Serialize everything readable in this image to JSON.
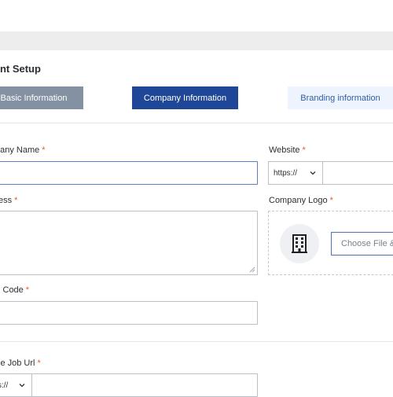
{
  "page": {
    "title": "unt Setup"
  },
  "steps": {
    "basic": "Basic Information",
    "company": "Company Information",
    "branding": "Branding information"
  },
  "form": {
    "company_name": {
      "label": "pany Name",
      "required_mark": "*",
      "value": ""
    },
    "address": {
      "label": "ess",
      "required_mark": "*",
      "value": ""
    },
    "postal_code": {
      "label": "l Code",
      "required_mark": "*",
      "value": ""
    },
    "job_url": {
      "label": "le Job Url",
      "required_mark": "*",
      "protocol": "s://",
      "value": ""
    },
    "website": {
      "label": "Website",
      "required_mark": "*",
      "protocol": "https://",
      "value": ""
    },
    "company_logo": {
      "label": "Company Logo",
      "required_mark": "*",
      "button": "Choose File &",
      "icon": "building-icon"
    }
  },
  "colors": {
    "step_active": "#1f4797",
    "step_done": "#8391a2",
    "step_next_bg": "#eef4fd",
    "required": "#e05a3a"
  }
}
